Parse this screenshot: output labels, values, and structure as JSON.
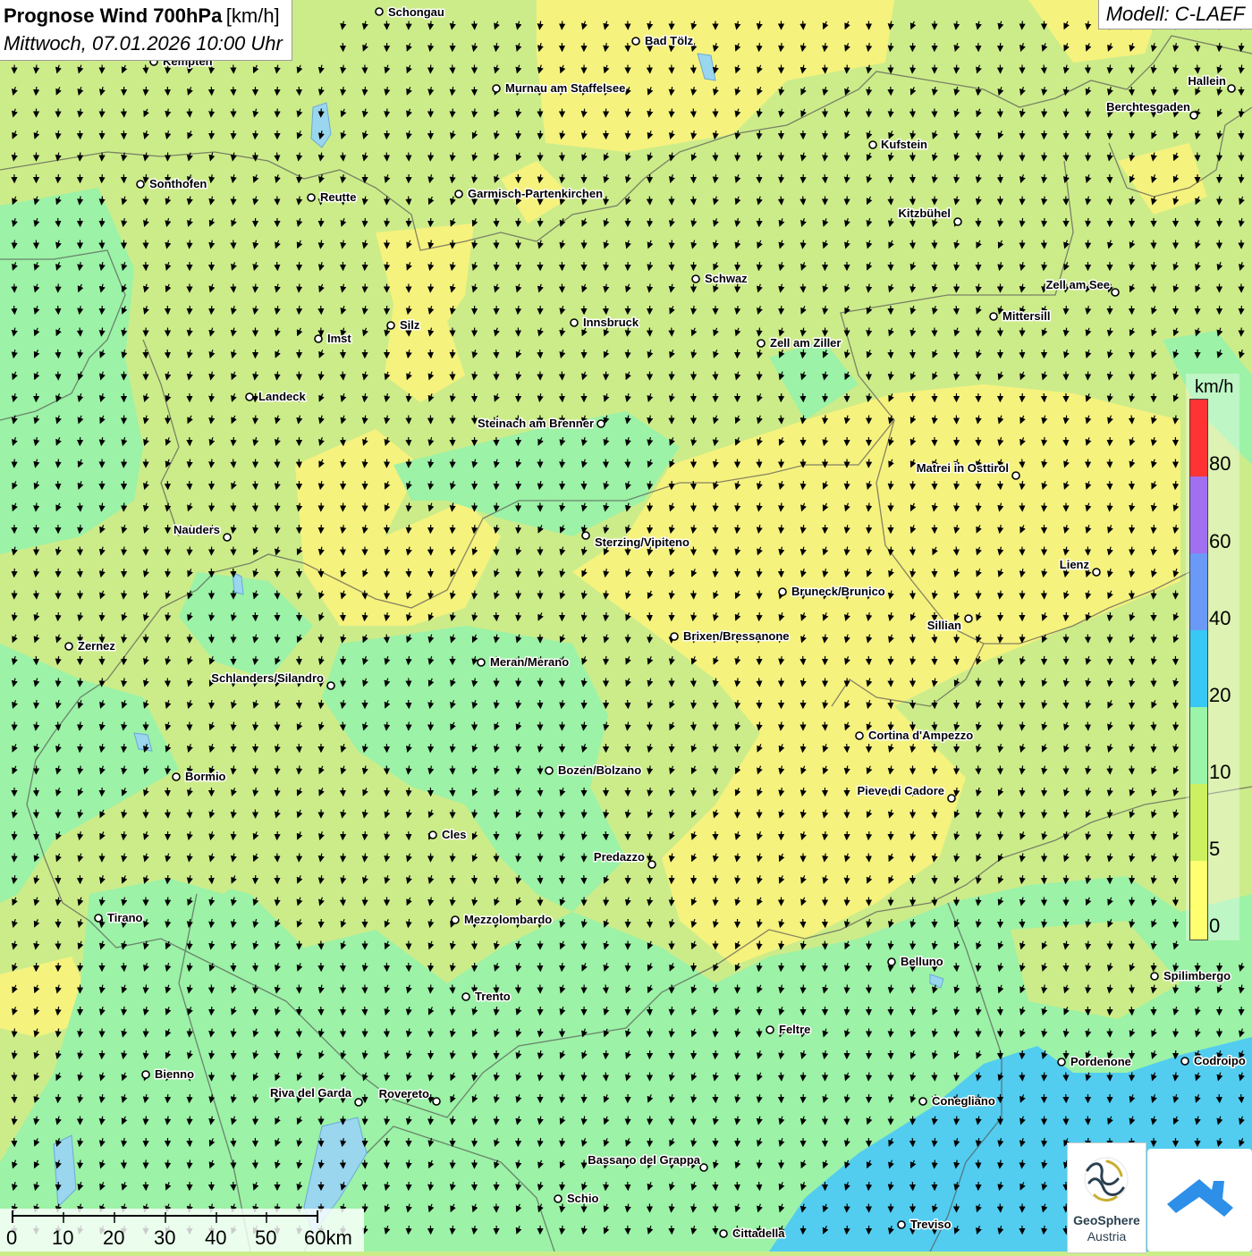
{
  "title": {
    "main": "Prognose Wind 700hPa",
    "unit": "[km/h]",
    "subtitle": "Mittwoch, 07.01.2026 10:00 Uhr"
  },
  "model": "Modell: C-LAEF",
  "legend": {
    "unit": "km/h",
    "ticks": [
      "80",
      "60",
      "40",
      "20",
      "10",
      "5",
      "0"
    ],
    "colors": [
      "#ff3333",
      "#a070f0",
      "#6a9af5",
      "#38c8f5",
      "#9af5a8",
      "#ccf060",
      "#ffff70"
    ]
  },
  "scale": {
    "ticks": [
      "0",
      "10",
      "20",
      "30",
      "40",
      "50",
      "60km"
    ]
  },
  "logos": {
    "geosphere_line1": "GeoSphere",
    "geosphere_line2": "Austria"
  },
  "wind_direction": "north-northwest (arrows pointing south-southeast)",
  "cities": [
    {
      "name": "Schongau"
    },
    {
      "name": "Bad Tölz"
    },
    {
      "name": "Kempten"
    },
    {
      "name": "Murnau am Staffelsee"
    },
    {
      "name": "Hallein"
    },
    {
      "name": "Berchtesgaden"
    },
    {
      "name": "Kufstein"
    },
    {
      "name": "Sonthofen"
    },
    {
      "name": "Reutte"
    },
    {
      "name": "Garmisch-Partenkirchen"
    },
    {
      "name": "Kitzbühel"
    },
    {
      "name": "Schwaz"
    },
    {
      "name": "Zell am See"
    },
    {
      "name": "Mittersill"
    },
    {
      "name": "Imst"
    },
    {
      "name": "Silz"
    },
    {
      "name": "Innsbruck"
    },
    {
      "name": "Zell am Ziller"
    },
    {
      "name": "Landeck"
    },
    {
      "name": "Steinach am Brenner"
    },
    {
      "name": "Matrei in Osttirol"
    },
    {
      "name": "Nauders"
    },
    {
      "name": "Sterzing/Vipiteno"
    },
    {
      "name": "Lienz"
    },
    {
      "name": "Bruneck/Brunico"
    },
    {
      "name": "Sillian"
    },
    {
      "name": "Zernez"
    },
    {
      "name": "Brixen/Bressanone"
    },
    {
      "name": "Meran/Merano"
    },
    {
      "name": "Schlanders/Silandro"
    },
    {
      "name": "Cortina d'Ampezzo"
    },
    {
      "name": "Bozen/Bolzano"
    },
    {
      "name": "Bormio"
    },
    {
      "name": "Pieve di Cadore"
    },
    {
      "name": "Cles"
    },
    {
      "name": "Predazzo"
    },
    {
      "name": "Tirano"
    },
    {
      "name": "Mezzolombardo"
    },
    {
      "name": "Belluno"
    },
    {
      "name": "Spilimbergo"
    },
    {
      "name": "Trento"
    },
    {
      "name": "Feltre"
    },
    {
      "name": "Pordenone"
    },
    {
      "name": "Codroipo"
    },
    {
      "name": "Bienno"
    },
    {
      "name": "Riva del Garda"
    },
    {
      "name": "Rovereto"
    },
    {
      "name": "Conegliano"
    },
    {
      "name": "Bassano del Grappa"
    },
    {
      "name": "Schio"
    },
    {
      "name": "Treviso"
    },
    {
      "name": "Cittadella"
    }
  ]
}
